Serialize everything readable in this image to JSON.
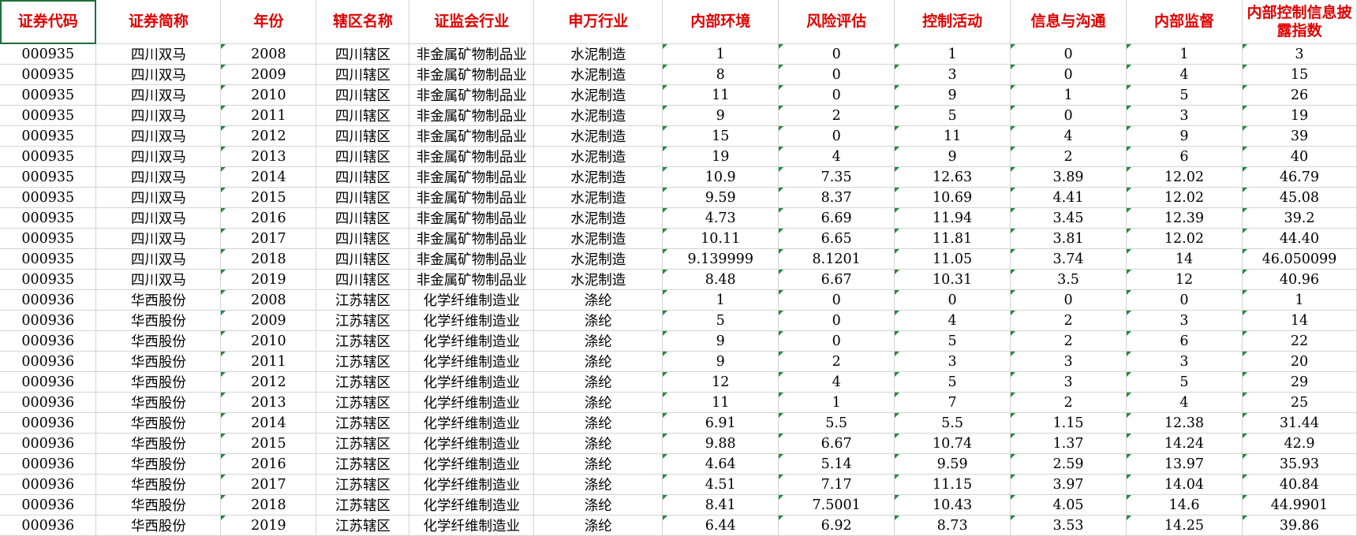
{
  "headers": [
    "证券代码",
    "证券简称",
    "年份",
    "辖区名称",
    "证监会行业",
    "申万行业",
    "内部环境",
    "风险评估",
    "控制活动",
    "信息与沟通",
    "内部监督",
    "内部控制信息披露指数"
  ],
  "rows": [
    [
      "000935",
      "四川双马",
      "2008",
      "四川辖区",
      "非金属矿物制品业",
      "水泥制造",
      "1",
      "0",
      "1",
      "0",
      "1",
      "3"
    ],
    [
      "000935",
      "四川双马",
      "2009",
      "四川辖区",
      "非金属矿物制品业",
      "水泥制造",
      "8",
      "0",
      "3",
      "0",
      "4",
      "15"
    ],
    [
      "000935",
      "四川双马",
      "2010",
      "四川辖区",
      "非金属矿物制品业",
      "水泥制造",
      "11",
      "0",
      "9",
      "1",
      "5",
      "26"
    ],
    [
      "000935",
      "四川双马",
      "2011",
      "四川辖区",
      "非金属矿物制品业",
      "水泥制造",
      "9",
      "2",
      "5",
      "0",
      "3",
      "19"
    ],
    [
      "000935",
      "四川双马",
      "2012",
      "四川辖区",
      "非金属矿物制品业",
      "水泥制造",
      "15",
      "0",
      "11",
      "4",
      "9",
      "39"
    ],
    [
      "000935",
      "四川双马",
      "2013",
      "四川辖区",
      "非金属矿物制品业",
      "水泥制造",
      "19",
      "4",
      "9",
      "2",
      "6",
      "40"
    ],
    [
      "000935",
      "四川双马",
      "2014",
      "四川辖区",
      "非金属矿物制品业",
      "水泥制造",
      "10.9",
      "7.35",
      "12.63",
      "3.89",
      "12.02",
      "46.79"
    ],
    [
      "000935",
      "四川双马",
      "2015",
      "四川辖区",
      "非金属矿物制品业",
      "水泥制造",
      "9.59",
      "8.37",
      "10.69",
      "4.41",
      "12.02",
      "45.08"
    ],
    [
      "000935",
      "四川双马",
      "2016",
      "四川辖区",
      "非金属矿物制品业",
      "水泥制造",
      "4.73",
      "6.69",
      "11.94",
      "3.45",
      "12.39",
      "39.2"
    ],
    [
      "000935",
      "四川双马",
      "2017",
      "四川辖区",
      "非金属矿物制品业",
      "水泥制造",
      "10.11",
      "6.65",
      "11.81",
      "3.81",
      "12.02",
      "44.40"
    ],
    [
      "000935",
      "四川双马",
      "2018",
      "四川辖区",
      "非金属矿物制品业",
      "水泥制造",
      "9.139999",
      "8.1201",
      "11.05",
      "3.74",
      "14",
      "46.050099"
    ],
    [
      "000935",
      "四川双马",
      "2019",
      "四川辖区",
      "非金属矿物制品业",
      "水泥制造",
      "8.48",
      "6.67",
      "10.31",
      "3.5",
      "12",
      "40.96"
    ],
    [
      "000936",
      "华西股份",
      "2008",
      "江苏辖区",
      "化学纤维制造业",
      "涤纶",
      "1",
      "0",
      "0",
      "0",
      "0",
      "1"
    ],
    [
      "000936",
      "华西股份",
      "2009",
      "江苏辖区",
      "化学纤维制造业",
      "涤纶",
      "5",
      "0",
      "4",
      "2",
      "3",
      "14"
    ],
    [
      "000936",
      "华西股份",
      "2010",
      "江苏辖区",
      "化学纤维制造业",
      "涤纶",
      "9",
      "0",
      "5",
      "2",
      "6",
      "22"
    ],
    [
      "000936",
      "华西股份",
      "2011",
      "江苏辖区",
      "化学纤维制造业",
      "涤纶",
      "9",
      "2",
      "3",
      "3",
      "3",
      "20"
    ],
    [
      "000936",
      "华西股份",
      "2012",
      "江苏辖区",
      "化学纤维制造业",
      "涤纶",
      "12",
      "4",
      "5",
      "3",
      "5",
      "29"
    ],
    [
      "000936",
      "华西股份",
      "2013",
      "江苏辖区",
      "化学纤维制造业",
      "涤纶",
      "11",
      "1",
      "7",
      "2",
      "4",
      "25"
    ],
    [
      "000936",
      "华西股份",
      "2014",
      "江苏辖区",
      "化学纤维制造业",
      "涤纶",
      "6.91",
      "5.5",
      "5.5",
      "1.15",
      "12.38",
      "31.44"
    ],
    [
      "000936",
      "华西股份",
      "2015",
      "江苏辖区",
      "化学纤维制造业",
      "涤纶",
      "9.88",
      "6.67",
      "10.74",
      "1.37",
      "14.24",
      "42.9"
    ],
    [
      "000936",
      "华西股份",
      "2016",
      "江苏辖区",
      "化学纤维制造业",
      "涤纶",
      "4.64",
      "5.14",
      "9.59",
      "2.59",
      "13.97",
      "35.93"
    ],
    [
      "000936",
      "华西股份",
      "2017",
      "江苏辖区",
      "化学纤维制造业",
      "涤纶",
      "4.51",
      "7.17",
      "11.15",
      "3.97",
      "14.04",
      "40.84"
    ],
    [
      "000936",
      "华西股份",
      "2018",
      "江苏辖区",
      "化学纤维制造业",
      "涤纶",
      "8.41",
      "7.5001",
      "10.43",
      "4.05",
      "14.6",
      "44.9901"
    ],
    [
      "000936",
      "华西股份",
      "2019",
      "江苏辖区",
      "化学纤维制造业",
      "涤纶",
      "6.44",
      "6.92",
      "8.73",
      "3.53",
      "14.25",
      "39.86"
    ]
  ],
  "colors": {
    "header_text": "#e00000",
    "gridline": "#d4d4d4",
    "selection": "#1e6f3a",
    "error_marker": "#1e8c3a"
  }
}
